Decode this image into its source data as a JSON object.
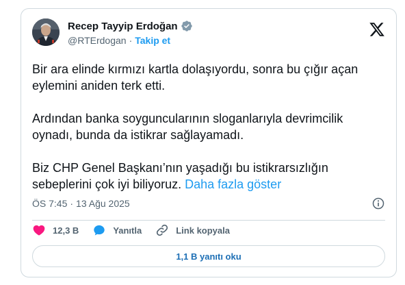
{
  "author": {
    "display_name": "Recep Tayyip Erdoğan",
    "handle": "@RTErdogan",
    "separator": "·",
    "follow_label": "Takip et"
  },
  "tweet": {
    "paragraph_1": "Bir ara elinde kırmızı kartla dolaşıyordu, sonra bu çığır açan eylemini aniden terk etti.",
    "paragraph_2": "Ardından banka soyguncularının sloganlarıyla devrimcilik oynadı, bunda da istikrar sağlayamadı.",
    "paragraph_3": "Biz CHP Genel Başkanı’nın yaşadığı bu istikrarsızlığın sebeplerini çok iyi biliyoruz.",
    "show_more_label": "Daha fazla göster",
    "time": "ÖS 7:45",
    "separator": "·",
    "date": "13 Ağu 2025"
  },
  "actions": {
    "likes_count": "12,3 B",
    "reply_label": "Yanıtla",
    "copy_link_label": "Link kopyala"
  },
  "read_replies_label": "1,1 B yanıtı oku",
  "icons": {
    "avatar": "profile-photo",
    "verified": "verified-badge-icon",
    "brand": "x-logo-icon",
    "info": "info-icon",
    "like": "heart-icon",
    "reply": "reply-bubble-icon",
    "link": "link-icon"
  },
  "colors": {
    "accent": "#1d9bf0",
    "like": "#f91880",
    "text": "#0f1419",
    "secondary": "#536471",
    "border": "#cfd9de"
  }
}
